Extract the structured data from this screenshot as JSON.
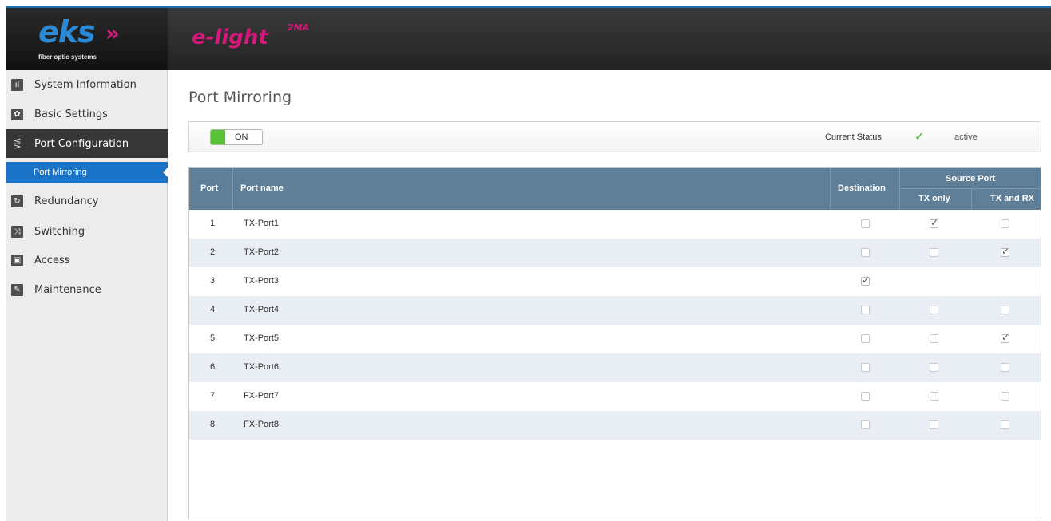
{
  "header": {
    "logo_main": "eks",
    "logo_arrows": "»",
    "logo_sub": "fiber optic systems",
    "brand": "e-light",
    "brand_sup": "2MA"
  },
  "sidebar": {
    "items": [
      {
        "label": "System Information",
        "icon": "chart-icon",
        "glyph": "ıl"
      },
      {
        "label": "Basic Settings",
        "icon": "gear-icon",
        "glyph": "✿"
      },
      {
        "label": "Port Configuration",
        "icon": "port-icon",
        "glyph": "⋚"
      },
      {
        "label": "Redundancy",
        "icon": "redundancy-icon",
        "glyph": "↻"
      },
      {
        "label": "Switching",
        "icon": "switch-icon",
        "glyph": "⤨"
      },
      {
        "label": "Access",
        "icon": "lock-icon",
        "glyph": "▣"
      },
      {
        "label": "Maintenance",
        "icon": "wrench-icon",
        "glyph": "✎"
      }
    ],
    "sub_item": "Port Mirroring"
  },
  "main": {
    "title": "Port Mirroring",
    "toggle_label": "ON",
    "current_status_label": "Current Status",
    "status_check": "✓",
    "status_value": "active",
    "table": {
      "headers": {
        "port": "Port",
        "port_name": "Port name",
        "destination": "Destination",
        "source_port": "Source Port",
        "tx_only": "TX only",
        "tx_and_rx": "TX and RX"
      },
      "rows": [
        {
          "port": "1",
          "name": "TX-Port1",
          "destination": false,
          "tx_only": true,
          "tx_and_rx": false
        },
        {
          "port": "2",
          "name": "TX-Port2",
          "destination": false,
          "tx_only": false,
          "tx_and_rx": true
        },
        {
          "port": "3",
          "name": "TX-Port3",
          "destination": true,
          "tx_only": null,
          "tx_and_rx": null
        },
        {
          "port": "4",
          "name": "TX-Port4",
          "destination": false,
          "tx_only": false,
          "tx_and_rx": false
        },
        {
          "port": "5",
          "name": "TX-Port5",
          "destination": false,
          "tx_only": false,
          "tx_and_rx": true
        },
        {
          "port": "6",
          "name": "TX-Port6",
          "destination": false,
          "tx_only": false,
          "tx_and_rx": false
        },
        {
          "port": "7",
          "name": "FX-Port7",
          "destination": false,
          "tx_only": false,
          "tx_and_rx": false
        },
        {
          "port": "8",
          "name": "FX-Port8",
          "destination": false,
          "tx_only": false,
          "tx_and_rx": false
        }
      ]
    }
  },
  "colors": {
    "accent_blue": "#1a73c7",
    "brand_magenta": "#d4197a",
    "table_header": "#5f7f98",
    "status_green": "#4cb030"
  }
}
